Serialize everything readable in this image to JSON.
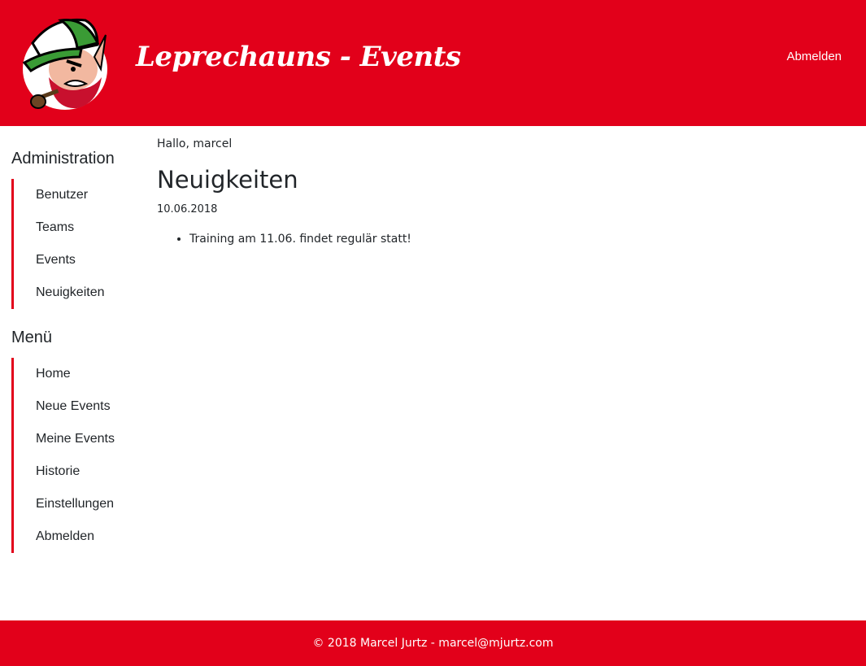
{
  "header": {
    "title": "Leprechauns - Events",
    "logout_label": "Abmelden",
    "brand_color": "#e2001a"
  },
  "sidebar": {
    "admin_heading": "Administration",
    "admin_items": [
      {
        "label": "Benutzer"
      },
      {
        "label": "Teams"
      },
      {
        "label": "Events"
      },
      {
        "label": "Neuigkeiten"
      }
    ],
    "menu_heading": "Menü",
    "menu_items": [
      {
        "label": "Home"
      },
      {
        "label": "Neue Events"
      },
      {
        "label": "Meine Events"
      },
      {
        "label": "Historie"
      },
      {
        "label": "Einstellungen"
      },
      {
        "label": "Abmelden"
      }
    ]
  },
  "main": {
    "greeting": "Hallo, marcel",
    "news_title": "Neuigkeiten",
    "news": [
      {
        "date": "10.06.2018",
        "items": [
          "Training am 11.06. findet regulär statt!"
        ]
      }
    ]
  },
  "footer": {
    "text": "© 2018 Marcel Jurtz - marcel@mjurtz.com"
  }
}
